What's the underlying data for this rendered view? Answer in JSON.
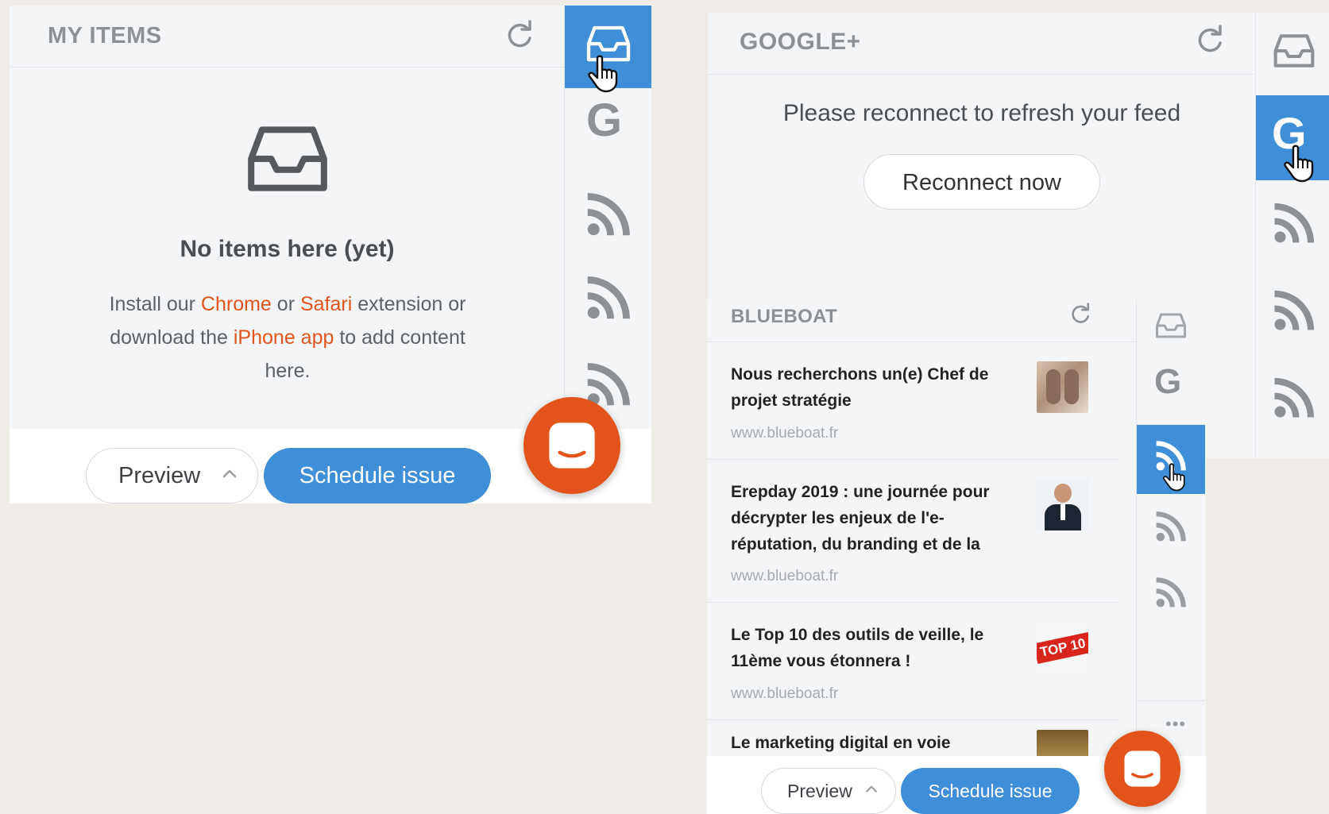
{
  "my_items": {
    "title": "MY ITEMS",
    "empty_title": "No items here (yet)",
    "empty_text": {
      "part1": "Install our ",
      "chrome": "Chrome",
      "part2": " or ",
      "safari": "Safari",
      "part3": " extension or download the ",
      "iphone": "iPhone app",
      "part4": " to add content here."
    },
    "footer": {
      "preview": "Preview",
      "schedule": "Schedule issue"
    },
    "sidebar": [
      "inbox-icon",
      "google-icon",
      "rss-icon",
      "rss-icon",
      "rss-icon"
    ]
  },
  "google_plus": {
    "title": "GOOGLE+",
    "notice": "Please reconnect to refresh your feed",
    "reconnect": "Reconnect now",
    "sidebar": [
      "inbox-icon",
      "google-icon",
      "rss-icon",
      "rss-icon",
      "rss-icon"
    ]
  },
  "blueboat": {
    "title": "BLUEBOAT",
    "items": [
      {
        "title": "Nous recherchons un(e) Chef de projet stratégie",
        "source": "www.blueboat.fr"
      },
      {
        "title": "Erepday 2019 : une journée pour décrypter les enjeux de l'e-réputation, du branding et de la",
        "source": "www.blueboat.fr"
      },
      {
        "title": "Le Top 10 des outils de veille, le 11ème vous étonnera !",
        "source": "www.blueboat.fr",
        "thumb_text": "TOP 10"
      },
      {
        "title": "Le marketing digital en voie",
        "source": ""
      }
    ],
    "more": "•••",
    "footer": {
      "preview": "Preview",
      "schedule": "Schedule issue"
    },
    "sidebar": [
      "inbox-icon",
      "google-icon",
      "rss-icon",
      "rss-icon",
      "rss-icon"
    ]
  },
  "colors": {
    "accent": "#3f8ed8",
    "brand_orange": "#e2541b",
    "panel_bg": "#f4f5f7"
  }
}
